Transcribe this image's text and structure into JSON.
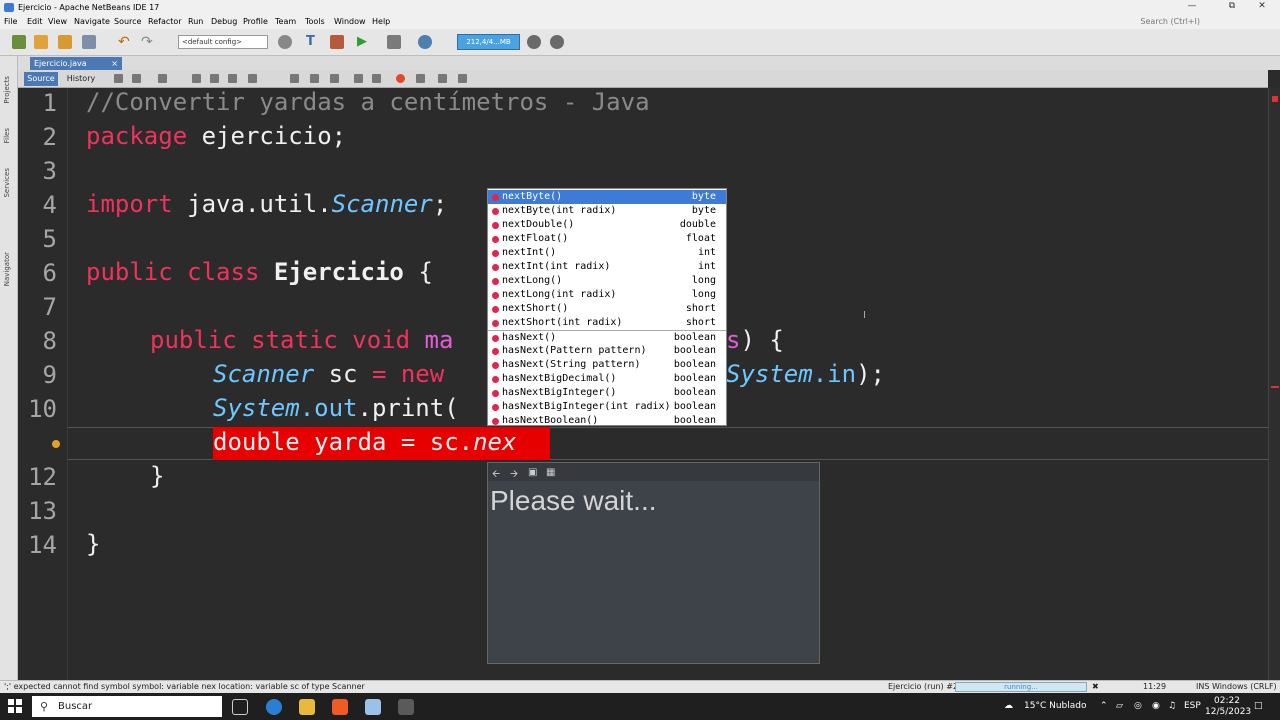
{
  "window": {
    "title": "Ejercicio - Apache NetBeans IDE 17"
  },
  "menu": [
    "File",
    "Edit",
    "View",
    "Navigate",
    "Source",
    "Refactor",
    "Run",
    "Debug",
    "Profile",
    "Team",
    "Tools",
    "Window",
    "Help"
  ],
  "search_placeholder": "Search (Ctrl+I)",
  "toolbar": {
    "config": "<default config>",
    "memory": "212,4/4...MB"
  },
  "sidebar_tabs": [
    "Projects",
    "Files",
    "Services",
    "Navigator"
  ],
  "file_tab": "Ejercicio.java",
  "editor_modes": {
    "source": "Source",
    "history": "History"
  },
  "line_numbers": [
    "1",
    "2",
    "3",
    "4",
    "5",
    "6",
    "7",
    "8",
    "9",
    "10",
    "12",
    "13",
    "14"
  ],
  "code": {
    "l1": "//Convertir yardas a centímetros - Java",
    "l2_kw": "package",
    "l2_rest": " ejercicio;",
    "l4_kw": "import",
    "l4_pkg": " java.util.",
    "l4_cls": "Scanner",
    "l4_end": ";",
    "l6_kw": "public class",
    "l6_name": " Ejercicio",
    "l6_end": " {",
    "l8_kw": "public static void",
    "l8_fn": " ma",
    "l8_s": "s",
    "l8_end": ") {",
    "l9_cls": "Scanner",
    "l9_mid": " sc ",
    "l9_eq": "=",
    "l9_new": " new",
    "l9_sys": "System",
    "l9_in": ".in",
    "l9_end": ");",
    "l10_sys": "System",
    "l10_out": ".out",
    "l10_rest": ".print(",
    "l11_text": "double yarda = sc.",
    "l11_it": "nex",
    "l12": "}",
    "l14": "}"
  },
  "completion": [
    {
      "name": "nextByte()",
      "type": "byte"
    },
    {
      "name": "nextByte(int radix)",
      "type": "byte"
    },
    {
      "name": "nextDouble()",
      "type": "double"
    },
    {
      "name": "nextFloat()",
      "type": "float"
    },
    {
      "name": "nextInt()",
      "type": "int"
    },
    {
      "name": "nextInt(int radix)",
      "type": "int"
    },
    {
      "name": "nextLong()",
      "type": "long"
    },
    {
      "name": "nextLong(int radix)",
      "type": "long"
    },
    {
      "name": "nextShort()",
      "type": "short"
    },
    {
      "name": "nextShort(int radix)",
      "type": "short"
    },
    {
      "name": "hasNext()",
      "type": "boolean"
    },
    {
      "name": "hasNext(Pattern pattern)",
      "type": "boolean"
    },
    {
      "name": "hasNext(String pattern)",
      "type": "boolean"
    },
    {
      "name": "hasNextBigDecimal()",
      "type": "boolean"
    },
    {
      "name": "hasNextBigInteger()",
      "type": "boolean"
    },
    {
      "name": "hasNextBigInteger(int radix)",
      "type": "boolean"
    },
    {
      "name": "hasNextBoolean()",
      "type": "boolean"
    }
  ],
  "doc_popup": {
    "text": "Please wait..."
  },
  "status": {
    "message": "';' expected  cannot find symbol   symbol:   variable nex   location: variable sc of type Scanner",
    "run": "Ejercicio (run) #2",
    "progress": "running...",
    "position": "11:29",
    "mode": "INS  Windows (CRLF)"
  },
  "taskbar": {
    "search": "Buscar",
    "weather": "15°C  Nublado",
    "lang": "ESP",
    "time": "02:22",
    "date": "12/5/2023"
  },
  "colors": {
    "keyword": "#f0325d",
    "italic_class": "#6ec7ff",
    "method": "#e15ed6",
    "error_bg": "#e60000",
    "selection": "#3d7bd6"
  }
}
